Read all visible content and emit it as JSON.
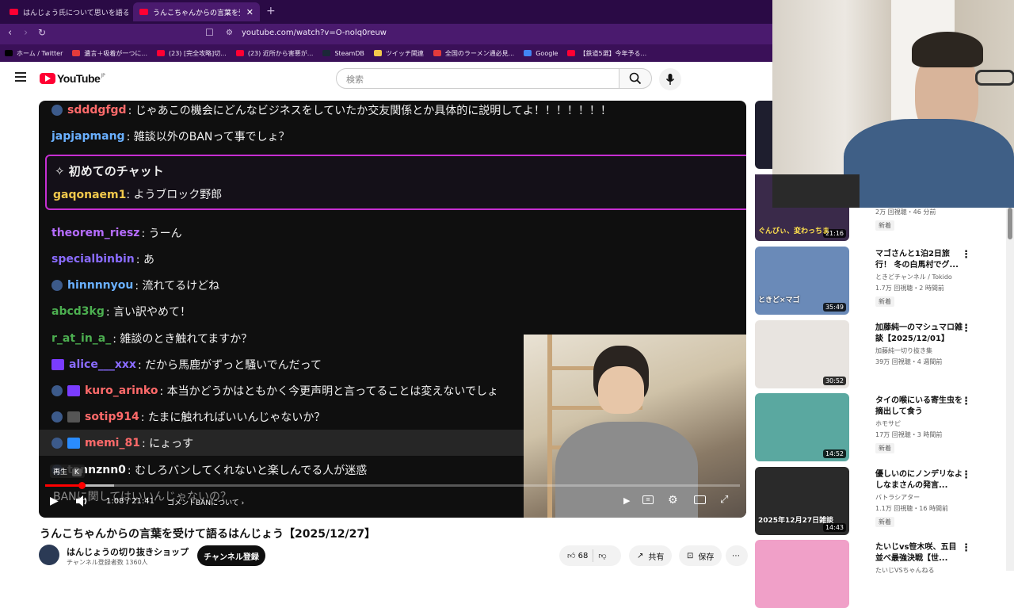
{
  "browser": {
    "tabs": [
      {
        "title": "はんじょう氏について思いを語る加藤純一",
        "active": false
      },
      {
        "title": "うんこちゃんからの言葉を受けて語るは",
        "active": true
      }
    ],
    "url": "youtube.com/watch?v=O-nolq0reuw",
    "bookmarks": [
      {
        "label": "ホーム / Twitter",
        "color": "#000000"
      },
      {
        "label": "遺言＋吸着が一つに...",
        "color": "#e23b3b"
      },
      {
        "label": "(23) [完全攻略]切...",
        "color": "#ff0033"
      },
      {
        "label": "(23) 近所から害悪が...",
        "color": "#ff0033"
      },
      {
        "label": "SteamDB",
        "color": "#1b2838"
      },
      {
        "label": "ツイッチ関連",
        "color": "#f2c94c"
      },
      {
        "label": "全国のラーメン通必見...",
        "color": "#e23b3b"
      },
      {
        "label": "Google",
        "color": "#4285f4"
      },
      {
        "label": "【鉄道5選】今年予る...",
        "color": "#ff0033"
      }
    ]
  },
  "youtube": {
    "logo_text": "YouTube",
    "logo_region": "JP",
    "search_placeholder": "検索"
  },
  "chat": [
    {
      "user": "sdddgfgd",
      "color": "#ff6a6a",
      "text": ": じゃあこの機会にどんなビジネスをしていたか交友関係とか具体的に説明してよ！！！！！！！",
      "avatar": true
    },
    {
      "user": "japjapmang",
      "color": "#6ab0ff",
      "text": ": 雑談以外のBANって事でしょ？",
      "avatar": false
    },
    {
      "user": "theorem_riesz",
      "color": "#b56cff",
      "text": ": うーん",
      "avatar": false
    },
    {
      "user": "specialbinbin",
      "color": "#8a6cff",
      "text": ": あ",
      "avatar": false
    },
    {
      "user": "hinnnnyou",
      "color": "#6ab0ff",
      "text": ": 流れてるけどね",
      "avatar": true
    },
    {
      "user": "abcd3kg",
      "color": "#4caf50",
      "text": ": 言い訳やめて！",
      "avatar": false
    },
    {
      "user": "r_at_in_a_",
      "color": "#4caf50",
      "text": ": 雑談のとき触れてますか？",
      "avatar": false
    },
    {
      "user": "alice___xxx",
      "color": "#8a6cff",
      "text": ": だから馬鹿がずっと騒いでんだって",
      "avatar": false,
      "badge": "#7a3cff"
    },
    {
      "user": "kuro_arinko",
      "color": "#ff6a6a",
      "text": ": 本当かどうかはともかく今更声明と言ってることは変えないでしょ",
      "avatar": true,
      "badge": "#7a3cff"
    },
    {
      "user": "sotip914",
      "color": "#ff6a6a",
      "text": ": たまに触れればいいんじゃないか？",
      "avatar": true,
      "badge": "#555555"
    },
    {
      "user": "memi_81",
      "color": "#ff6a6a",
      "text": ": にょっす",
      "avatar": true,
      "badge": "#2a8cff"
    },
    {
      "user": "tannznn0",
      "color": "#f1f1f1",
      "text": ": むしろバンしてくれないと楽しんでる人が迷惑",
      "avatar": true
    },
    {
      "user": "",
      "color": "#4caf50",
      "text": "BANに関してはいいんじゃないの？",
      "avatar": false
    }
  ],
  "first_chat": {
    "header": "初めてのチャット",
    "user": "gaqonaem1",
    "color": "#f2c94c",
    "text": ": ようブロック野郎"
  },
  "player": {
    "tooltip_label": "再生",
    "tooltip_key": "K",
    "time": "1:08 / 21:41",
    "chapter": "コメントBANについて",
    "progress_fraction": 0.052
  },
  "video": {
    "title": "うんこちゃんからの言葉を受けて語るはんじょう【2025/12/27】",
    "channel": "はんじょうの切り抜きショップ",
    "subscribers": "チャンネル登録者数 1360人",
    "subscribe_label": "チャンネル登録",
    "likes": "68",
    "share_label": "共有",
    "save_label": "保存"
  },
  "sidebar": [
    {
      "title": "",
      "meta1": "",
      "meta2": "2万 回視聴・46 分前",
      "new": "新着",
      "duration": "21:16",
      "thumb_color": "#3a2a4a"
    },
    {
      "title": "マゴさんと1泊2日旅行！ 冬の白馬村でグ...",
      "meta1": "ときどチャンネル / Tokido",
      "meta2": "1.7万 回視聴・2 時間前",
      "new": "新着",
      "duration": "35:49",
      "thumb_color": "#6a8ab8"
    },
    {
      "title": "加藤純一のマシュマロ雑談【2025/12/01】",
      "meta1": "加藤純一切り抜き集",
      "meta2": "39万 回視聴・4 週間前",
      "new": "",
      "duration": "30:52",
      "thumb_color": "#e8e4e0"
    },
    {
      "title": "タイの喉にいる寄生虫を摘出して食う",
      "meta1": "ホモサピ",
      "meta2": "17万 回視聴・3 時間前",
      "new": "新着",
      "duration": "14:52",
      "thumb_color": "#5aa8a0"
    },
    {
      "title": "優しいのにノンデリなよしなまさんの発言...",
      "meta1": "バトラシアター",
      "meta2": "1.1万 回視聴・16 時間前",
      "new": "新着",
      "duration": "14:43",
      "thumb_color": "#2a2a2a"
    },
    {
      "title": "たいじvs笹木咲、五目並べ最強決戦【世...",
      "meta1": "たいじVSちゃんねる",
      "meta2": "",
      "new": "",
      "duration": "",
      "thumb_color": "#f0a0c8"
    }
  ],
  "thumb_overlay_texts": [
    "ぐんびぃ、変わっちま",
    "ときど×マゴ",
    "2025年12月27日雑談"
  ]
}
